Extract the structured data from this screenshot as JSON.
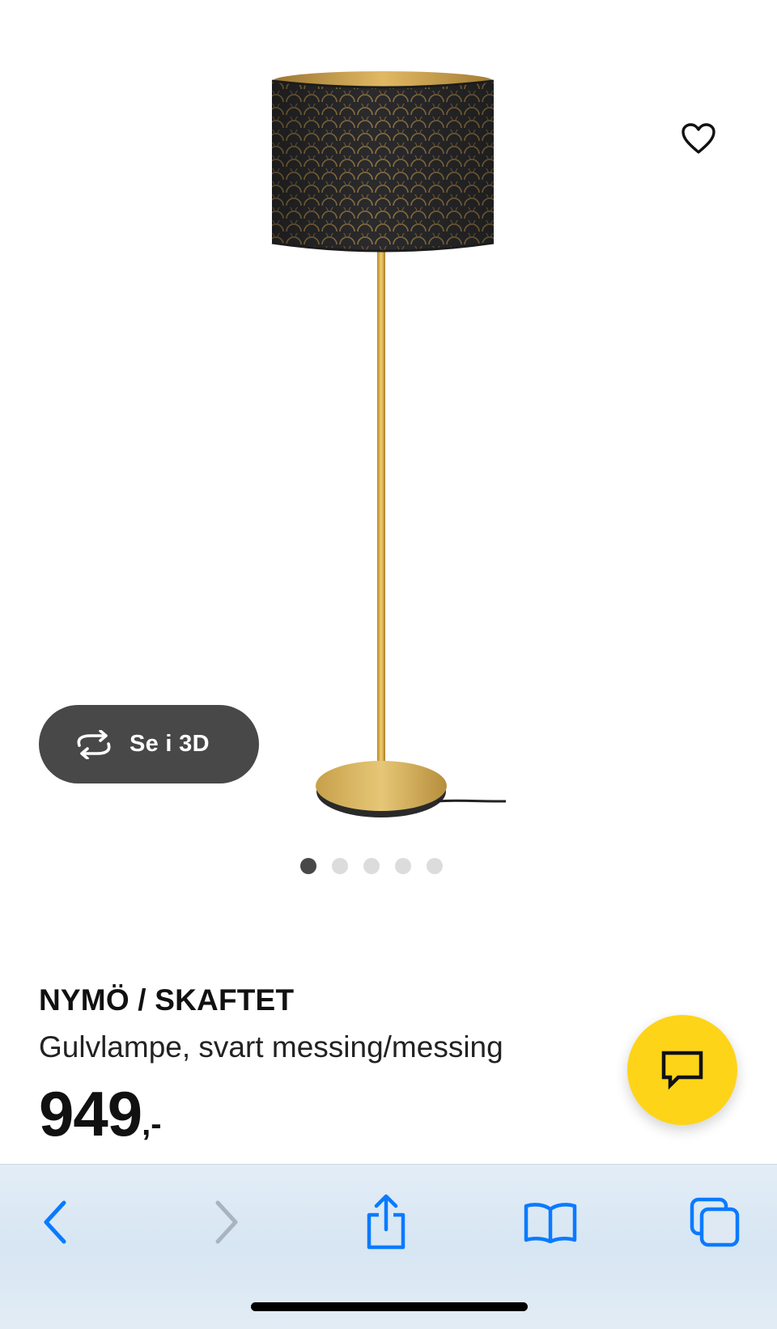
{
  "product": {
    "name": "NYMÖ / SKAFTET",
    "description": "Gulvlampe, svart messing/messing",
    "price_integer": "949",
    "price_suffix": ",-"
  },
  "hero": {
    "view_3d_label": "Se i 3D",
    "carousel": {
      "total_images": 5,
      "active_index": 0
    }
  },
  "icons": {
    "favorite": "heart-outline-icon",
    "view_3d": "rotate-3d-icon",
    "chat": "chat-bubble-icon",
    "back": "chevron-left-icon",
    "forward": "chevron-right-icon",
    "share": "share-icon",
    "bookmarks": "book-icon",
    "tabs": "tabs-icon"
  },
  "colors": {
    "chat_button": "#fdd418",
    "view_3d_button": "#484848",
    "browser_accent": "#0a7aff",
    "browser_disabled": "#a9b4c0"
  }
}
